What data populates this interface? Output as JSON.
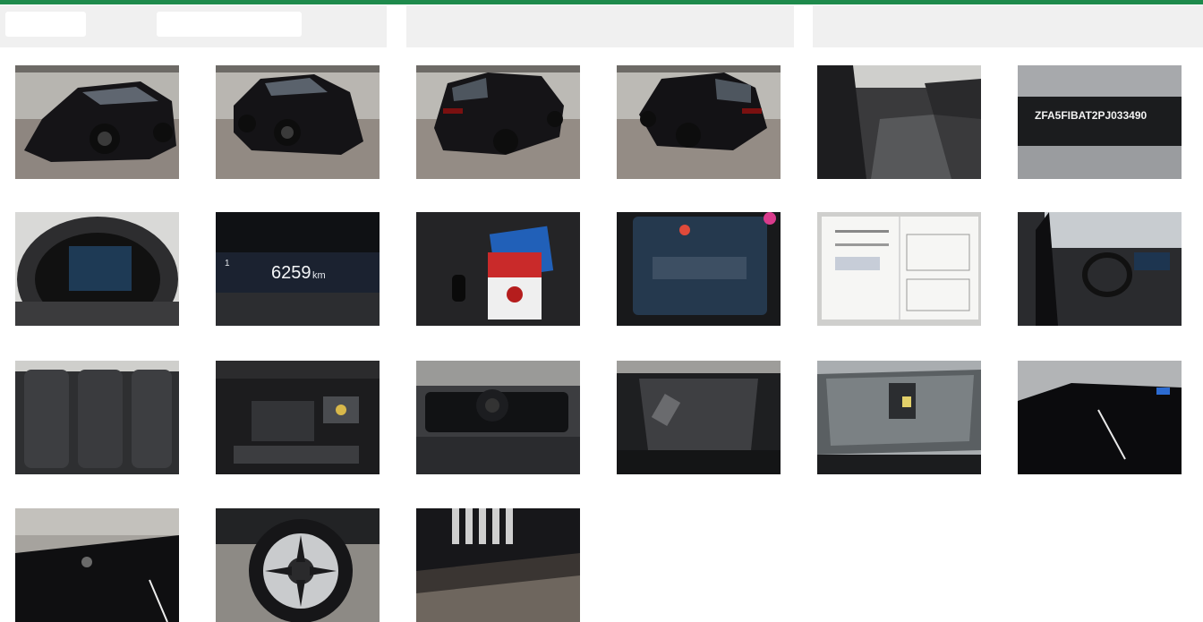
{
  "colors": {
    "accent": "#1e8a4c",
    "panel": "#f0f0f0"
  },
  "gallery": {
    "photos": [
      {
        "name": "photo-exterior-front-left"
      },
      {
        "name": "photo-exterior-front-right"
      },
      {
        "name": "photo-exterior-rear-left"
      },
      {
        "name": "photo-exterior-rear-right"
      },
      {
        "name": "photo-interior-front-seats"
      },
      {
        "name": "photo-vin-plate",
        "vin": "ZFA5FIBAT2PJ033490"
      },
      {
        "name": "photo-instrument-cluster"
      },
      {
        "name": "photo-odometer",
        "odometer": "6259",
        "unit": "km",
        "trip": "1"
      },
      {
        "name": "photo-keys-and-manual"
      },
      {
        "name": "photo-dashboard-display"
      },
      {
        "name": "photo-service-documents"
      },
      {
        "name": "photo-interior-dashboard"
      },
      {
        "name": "photo-rear-seats"
      },
      {
        "name": "photo-engine-bay"
      },
      {
        "name": "photo-spare-wheel-well"
      },
      {
        "name": "photo-boot"
      },
      {
        "name": "photo-windscreen"
      },
      {
        "name": "photo-roof"
      },
      {
        "name": "photo-roof-damage"
      },
      {
        "name": "photo-wheel"
      },
      {
        "name": "photo-front-grille"
      }
    ]
  }
}
